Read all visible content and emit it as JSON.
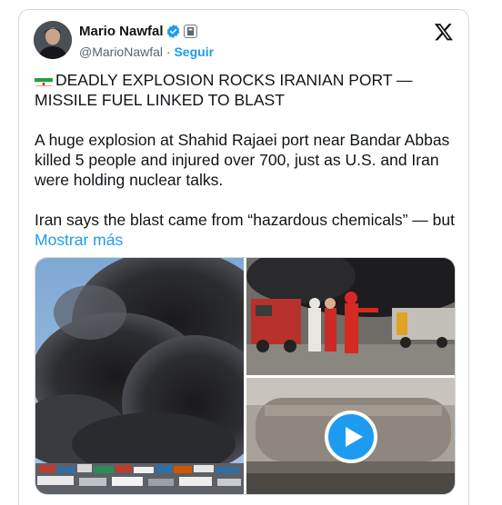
{
  "author": {
    "name": "Mario Nawfal",
    "handle": "@MarioNawfal",
    "separator": "·",
    "follow_label": "Seguir"
  },
  "icons": {
    "verified": "verified-badge-icon",
    "affiliate": "affiliate-badge-icon",
    "platform": "x-logo-icon",
    "flag": "iran-flag-icon",
    "play": "play-icon"
  },
  "tweet": {
    "headline": "DEADLY EXPLOSION ROCKS IRANIAN PORT — MISSILE FUEL LINKED TO BLAST",
    "paragraph1": "A huge explosion at Shahid Rajaei port near Bandar Abbas killed 5 people and injured over 700, just as U.S. and Iran were holding nuclear talks.",
    "paragraph2": "Iran says the blast came from “hazardous chemicals” — but",
    "more_label": "Mostrar más"
  },
  "colors": {
    "link": "#1d9bf0",
    "text": "#0f1419",
    "secondary": "#536471",
    "border": "#cfd9de"
  }
}
